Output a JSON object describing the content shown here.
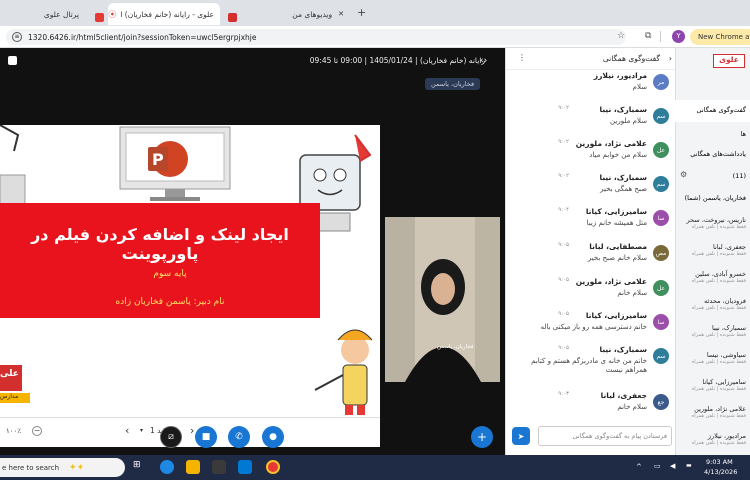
{
  "browser": {
    "tabs": [
      {
        "title": "پرتال علوی",
        "active": false
      },
      {
        "title": "علوی - رایانه (خانم فخاریان) ا",
        "active": true
      },
      {
        "title": "ویدیوهای من",
        "active": false
      }
    ],
    "new_tab": "+",
    "url": "1320.6426.ir/html5client/join?sessionToken=uwcl5ergrpjxhje",
    "profile_initial": "Y",
    "chrome_badge": "New Chrome ava"
  },
  "meeting": {
    "title": "رایانه (خانم فخاریان) | 1405/01/24 | 09:00 تا 09:45",
    "presenter_tag": "فخاریان، یاسمن"
  },
  "slide": {
    "title": "ایجاد لینک و اضافه کردن فیلم در پاورپوینت",
    "grade": "پایه سوم",
    "teacher": "نام دبیر: یاسمن فخاریان زاده",
    "logo_text": "علی",
    "logo_sub": "مدارس",
    "slide_label": "اسلاید 1",
    "zoom": "۱۰۰٪"
  },
  "webcam": {
    "name_tag": "فخاریان، یاسمن"
  },
  "chat": {
    "title": "گفت‌وگوی همگانی",
    "messages": [
      {
        "avatar": "مر",
        "name": "مرادیور، نیلارز",
        "time": "",
        "text": "سلام",
        "color": "#5b7cc4"
      },
      {
        "avatar": "سم",
        "name": "سمبارک، نیبا",
        "time": "۹:۰۲",
        "text": "سلام ملورین",
        "color": "#2e7d9a"
      },
      {
        "avatar": "عل",
        "name": "علامی نژاد، ملورین",
        "time": "۹:۰۲",
        "text": "سلام من خوابم میاد",
        "color": "#3f8f5f"
      },
      {
        "avatar": "سم",
        "name": "سمبارک، نیبا",
        "time": "۹:۰۲",
        "text": "صبح همگی بخیر",
        "color": "#2e7d9a"
      },
      {
        "avatar": "سا",
        "name": "سامیرزایی، کیانا",
        "time": "۹:۰۴",
        "text": "متل همیشه خانم زیبا",
        "color": "#9c4fa8"
      },
      {
        "avatar": "مص",
        "name": "مصطفایی، لبانا",
        "time": "۹:۰۵",
        "text": "سلام خانم صبح بخیر",
        "color": "#7a6a3a"
      },
      {
        "avatar": "عل",
        "name": "علامی نژاد، ملورین",
        "time": "۹:۰۵",
        "text": "سلام خانم",
        "color": "#3f8f5f"
      },
      {
        "avatar": "سا",
        "name": "سامیرزایی، کیانا",
        "time": "۹:۰۵",
        "text": "خانم دسترسی همه رو باز میکنی باله",
        "color": "#9c4fa8"
      },
      {
        "avatar": "سم",
        "name": "سمبارک، نیبا",
        "time": "۹:۰۵",
        "text": "خانم من خانه ی مادربزگم هستم و کتابم همراهم نیست",
        "color": "#2e7d9a"
      },
      {
        "avatar": "جع",
        "name": "جعفری، لبانا",
        "time": "۹:۰۳",
        "text": "سلام خانم",
        "color": "#3b5a8c"
      }
    ],
    "input_placeholder": "فرستادن پیام به گفت‌وگوی همگانی"
  },
  "users_panel": {
    "logo": "علوی",
    "items": [
      "گفت‌وگوی همگانی",
      "ها",
      "یادداشت‌های همگانی"
    ],
    "count_label": "(11)",
    "presenter": "فخاریان، یاسمن (شما)",
    "users": [
      {
        "name": "ناریس، نیروخت، سحر",
        "status": "فقط شنونده | تلفن همراه"
      },
      {
        "name": "جعفری، لبانا",
        "status": "فقط شنونده | تلفن همراه"
      },
      {
        "name": "خسرو آبادی، سلین",
        "status": "فقط شنونده | تلفن همراه"
      },
      {
        "name": "فرودیان، محدثه",
        "status": "فقط شنونده | تلفن همراه"
      },
      {
        "name": "سمبارک، نیبا",
        "status": "فقط شنونده | تلفن همراه"
      },
      {
        "name": "سیاوشی، نیسا",
        "status": "فقط شنونده | تلفن همراه"
      },
      {
        "name": "سامیرزایی، کیانا",
        "status": "فقط شنونده | تلفن همراه"
      },
      {
        "name": "علامی نژاد، ملورین",
        "status": "فقط شنونده | تلفن همراه"
      },
      {
        "name": "مرادیور، نیلارز",
        "status": "فقط شنونده | تلفن همراه"
      }
    ]
  },
  "taskbar": {
    "search": "e here to search",
    "time": "9:03 AM",
    "date": "4/13/2026"
  }
}
